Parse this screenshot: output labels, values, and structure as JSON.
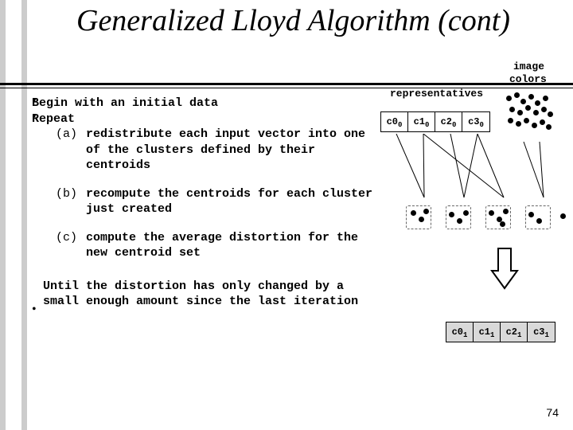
{
  "title": "Generalized Lloyd Algorithm (cont)",
  "labels": {
    "representatives": "representatives",
    "image": "image",
    "colors": "colors"
  },
  "algo": {
    "begin": "Begin with an initial data",
    "repeat": "Repeat",
    "a_tag": "(a)",
    "a_text": "redistribute each input vector into one of the clusters defined by their centroids",
    "b_tag": "(b)",
    "b_text": "recompute the centroids for each cluster just created",
    "c_tag": "(c)",
    "c_text": "compute the average distortion for the new centroid set",
    "until": "Until the distortion has only changed by a small enough amount since the last iteration"
  },
  "row0": {
    "c0": "c0",
    "c1": "c1",
    "c2": "c2",
    "c3": "c3",
    "sub": "0"
  },
  "row1": {
    "c0": "c0",
    "c1": "c1",
    "c2": "c2",
    "c3": "c3",
    "sub": "1"
  },
  "pagenum": "74"
}
